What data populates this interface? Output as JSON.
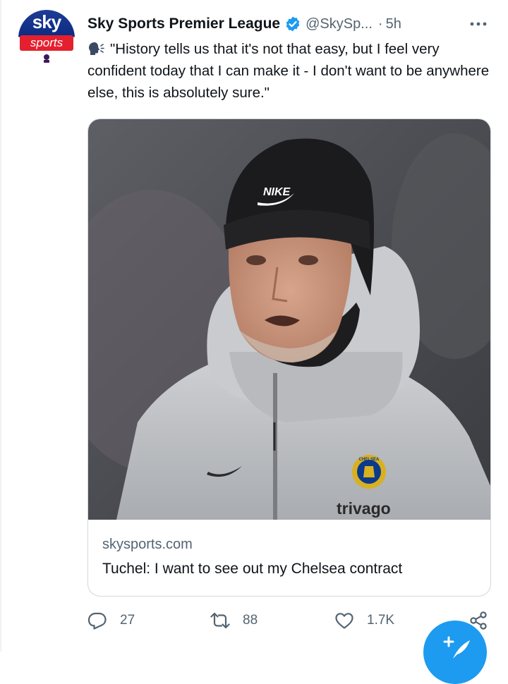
{
  "tweet": {
    "display_name": "Sky Sports Premier League",
    "handle": "@SkySp...",
    "separator": "·",
    "time": "5h",
    "text": "\"History tells us that it's not that easy, but I feel very confident today that I can make it - I don't want to be anywhere else, this is absolutely sure.\"",
    "avatar": {
      "brand_top": "sky",
      "brand_bottom": "sports"
    }
  },
  "card": {
    "domain": "skysports.com",
    "title": "Tuchel: I want to see out my Chelsea contract",
    "image_texts": {
      "beanie_logo": "NIKE",
      "sponsor": "trivago",
      "crest": "CHELSEA"
    }
  },
  "actions": {
    "reply_count": "27",
    "retweet_count": "88",
    "like_count": "1.7K"
  },
  "icons": {
    "verified": "verified-badge-icon",
    "more": "more-icon",
    "speaking": "speaking-head-icon",
    "reply": "reply-icon",
    "retweet": "retweet-icon",
    "like": "heart-icon",
    "share": "share-icon",
    "compose": "compose-tweet-icon"
  },
  "colors": {
    "accent": "#1d9bf0",
    "secondary_text": "#536471",
    "border": "#cfd9de",
    "sky_blue": "#0b2b82",
    "sky_red": "#e4202e"
  }
}
